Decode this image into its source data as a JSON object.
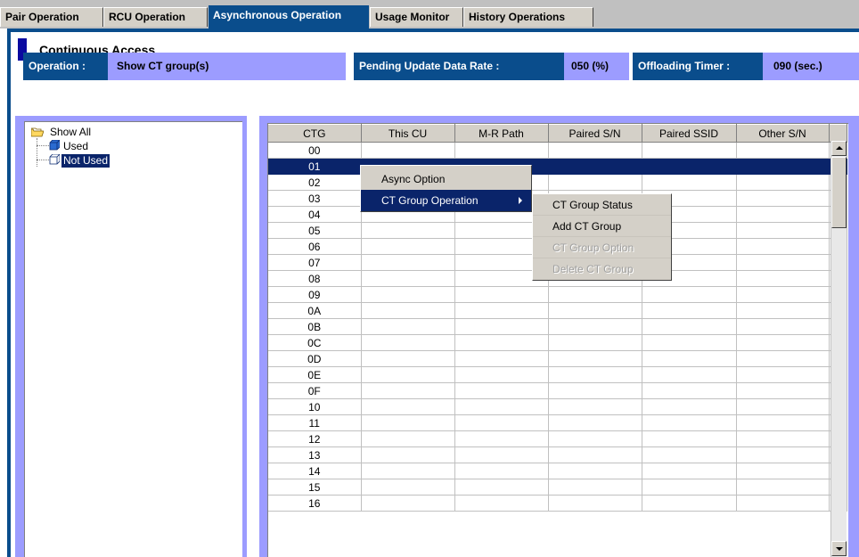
{
  "tabs": [
    {
      "label": "Pair Operation",
      "active": false
    },
    {
      "label": "RCU Operation",
      "active": false
    },
    {
      "label": "Asynchronous Operation",
      "active": true
    },
    {
      "label": "Usage Monitor",
      "active": false
    },
    {
      "label": "History Operations",
      "active": false
    }
  ],
  "page_title": "Continuous Access",
  "info": {
    "operation_label": "Operation :",
    "operation_value": "Show CT group(s)",
    "pending_label": "Pending Update Data Rate :",
    "pending_value": "050 (%)",
    "offloading_label": "Offloading Timer :",
    "offloading_value": "090 (sec.)"
  },
  "tree": {
    "root": "Show All",
    "children": [
      "Used",
      "Not Used"
    ],
    "selected": "Not Used"
  },
  "table": {
    "columns": [
      "CTG",
      "This CU",
      "M-R Path",
      "Paired S/N",
      "Paired SSID",
      "Other S/N"
    ],
    "rows": [
      "00",
      "01",
      "02",
      "03",
      "04",
      "05",
      "06",
      "07",
      "08",
      "09",
      "0A",
      "0B",
      "0C",
      "0D",
      "0E",
      "0F",
      "10",
      "11",
      "12",
      "13",
      "14",
      "15",
      "16"
    ],
    "selected_row": "01"
  },
  "context_menu": {
    "items": [
      "Async Option",
      "CT Group Operation"
    ],
    "highlighted": "CT Group Operation"
  },
  "submenu": {
    "items": [
      {
        "label": "CT Group Status",
        "enabled": true
      },
      {
        "label": "Add CT Group",
        "enabled": true
      },
      {
        "label": "CT Group Option",
        "enabled": false
      },
      {
        "label": "Delete CT Group",
        "enabled": false
      }
    ]
  },
  "colors": {
    "accent": "#0a4d8c",
    "selection": "#0a246a",
    "info_bg": "#9c9cff"
  }
}
